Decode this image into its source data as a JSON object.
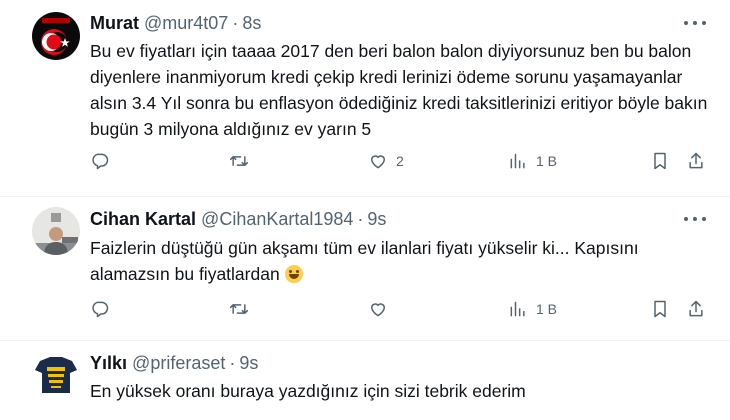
{
  "tweets": [
    {
      "name": "Murat",
      "handle": "@mur4t07",
      "time": "8s",
      "text": "Bu ev fiyatları için taaaa 2017 den beri balon balon diyiyorsunuz ben bu balon diyenlere inanmiyorum kredi çekip kredi lerinizi ödeme sorunu yaşamayanlar alsın 3.4 Yıl sonra bu enflasyon ödediğiniz kredi taksitlerinizi eritiyor böyle bakın bugün 3 milyona aldığınız ev yarın 5",
      "likes": "2",
      "views": "1 B"
    },
    {
      "name": "Cihan Kartal",
      "handle": "@CihanKartal1984",
      "time": "9s",
      "text": "Faizlerin düştüğü gün akşamı tüm ev ilanlari fiyatı yükselir ki... Kapısını alamazsın bu fiyatlardan",
      "views": "1 B"
    },
    {
      "name": "Yılkı",
      "handle": "@priferaset",
      "time": "9s",
      "text": "En yüksek oranı buraya yazdığınız için sizi tebrik ederim"
    }
  ],
  "separator": "·",
  "icons": {
    "reply": "reply-icon",
    "retweet": "retweet-icon",
    "like": "heart-icon",
    "views": "views-icon",
    "bookmark": "bookmark-icon",
    "share": "share-icon",
    "more": "more-icon"
  },
  "colors": {
    "text": "#0f1419",
    "secondary": "#536471",
    "divider": "#eff3f4"
  }
}
